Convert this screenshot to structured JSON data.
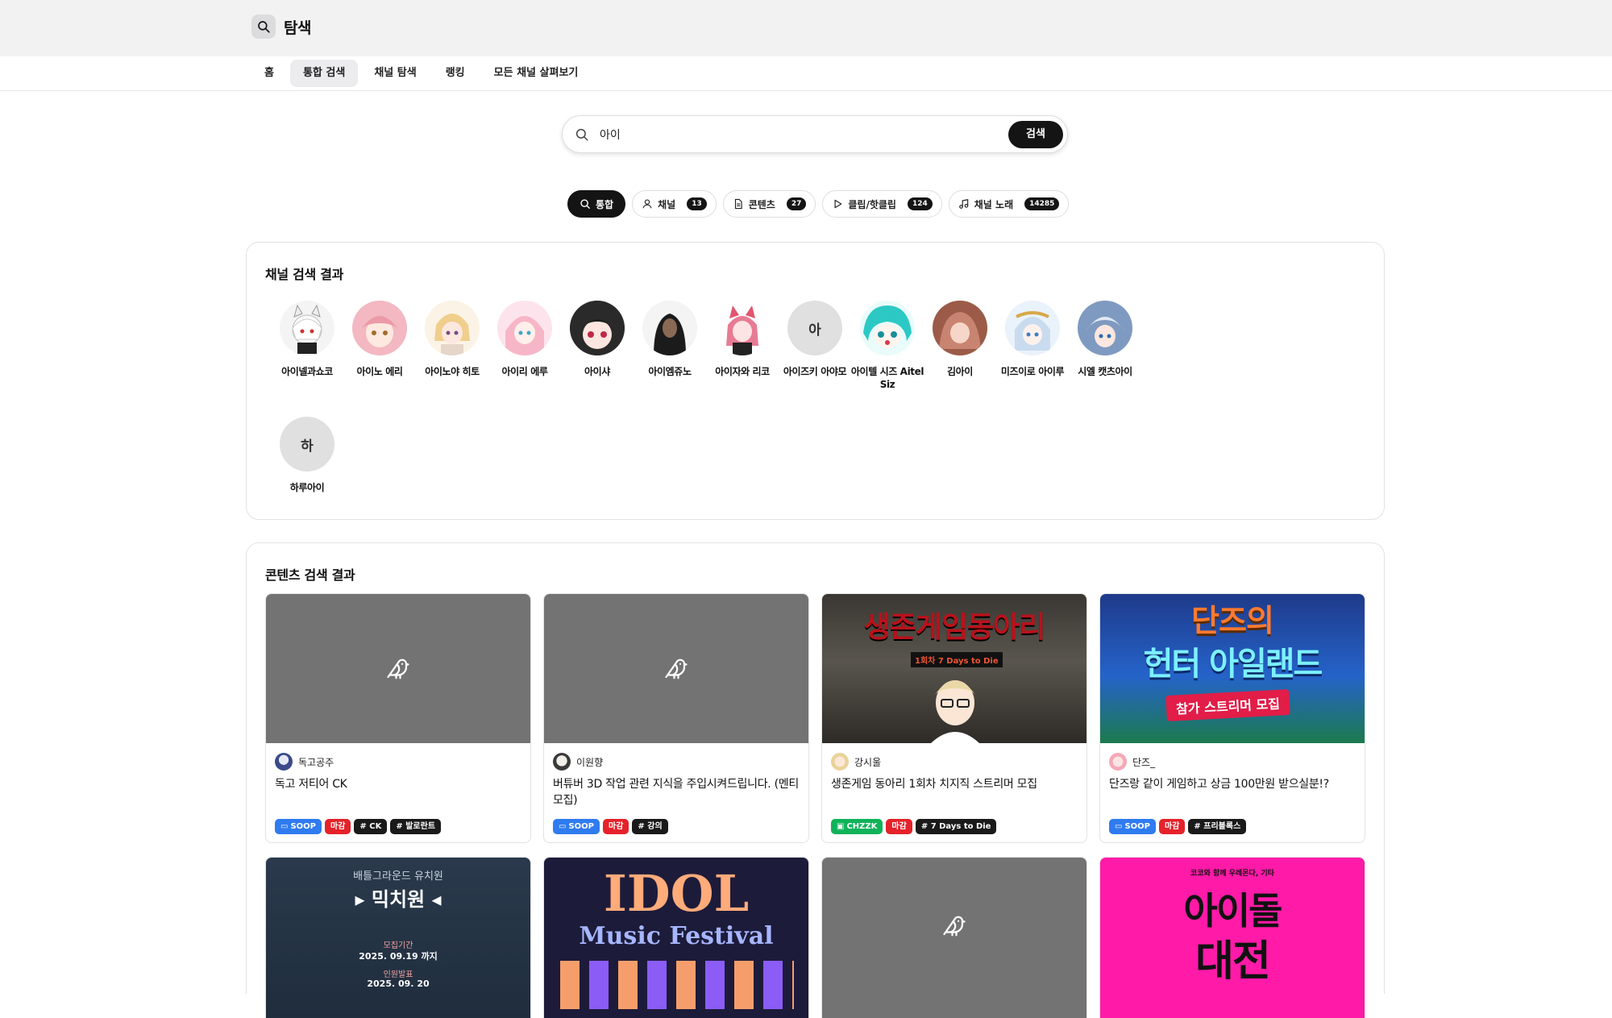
{
  "header": {
    "title": "탐색"
  },
  "nav": {
    "items": [
      {
        "label": "홈"
      },
      {
        "label": "통합 검색"
      },
      {
        "label": "채널 탐색"
      },
      {
        "label": "랭킹"
      },
      {
        "label": "모든 채널 살펴보기"
      }
    ]
  },
  "search": {
    "value": "아이",
    "button_label": "검색"
  },
  "filters": [
    {
      "label": "통합",
      "icon": "search-icon"
    },
    {
      "label": "채널",
      "count": "13",
      "icon": "user-icon"
    },
    {
      "label": "콘텐츠",
      "count": "27",
      "icon": "document-icon"
    },
    {
      "label": "클립/핫클립",
      "count": "124",
      "icon": "play-icon"
    },
    {
      "label": "채널 노래",
      "count": "14285",
      "icon": "music-icon"
    }
  ],
  "channels": {
    "title": "채널 검색 결과",
    "items": [
      {
        "name": "아이넬과쇼코"
      },
      {
        "name": "아이노 에리"
      },
      {
        "name": "아이노야 히토"
      },
      {
        "name": "아이리 에루"
      },
      {
        "name": "아이샤"
      },
      {
        "name": "아이엠쥬노"
      },
      {
        "name": "아이자와 리코"
      },
      {
        "name": "아이즈키 아야모",
        "initial": "아"
      },
      {
        "name": "아이텔 시즈 Aitel Siz"
      },
      {
        "name": "김아이"
      },
      {
        "name": "미즈이로 아이루"
      },
      {
        "name": "시엘 캣츠아이"
      },
      {
        "name": "하루아이",
        "initial": "하"
      }
    ]
  },
  "contents": {
    "title": "콘텐츠 검색 결과",
    "cards": [
      {
        "author": "독고공주",
        "title": "독고 저티어 CK",
        "platform": "SOOP",
        "status": "마감",
        "tags": [
          "# CK",
          "# 발로란트"
        ]
      },
      {
        "author": "이원향",
        "title": "버튜버 3D 작업 관련 지식을 주입시켜드립니다. (멘티 모집)",
        "platform": "SOOP",
        "status": "마감",
        "tags": [
          "# 강의"
        ]
      },
      {
        "author": "강시울",
        "title": "생존게임 동아리 1회차 치지직 스트리머 모집",
        "platform": "CHZZK",
        "status": "마감",
        "tags": [
          "# 7 Days to Die"
        ],
        "thumb_title": "생존게임동아리",
        "thumb_sub": "1회차 7 Days to Die"
      },
      {
        "author": "단즈_",
        "title": "단즈랑 같이 게임하고 상금 100만원 받으실분!?",
        "platform": "SOOP",
        "status": "마감",
        "tags": [
          "# 프리블록스"
        ],
        "thumb_title1": "단즈의",
        "thumb_title2": "헌터 아일랜드",
        "thumb_banner": "참가 스트리머 모집"
      }
    ],
    "row2": [
      {
        "thumb_top": "배틀그라운드 유치원",
        "thumb_title": "믹치원",
        "thumb_label": "모집기간",
        "thumb_date": "2025. 09.19 까지",
        "thumb_label2": "인원발표",
        "thumb_date2": "2025. 09. 20"
      },
      {
        "thumb_title1": "IDOL",
        "thumb_title2": "Music Festival"
      },
      {},
      {
        "thumb_top": "코코와 함께 우레몬다, 기타",
        "thumb_title1": "아이돌",
        "thumb_title2": "대전"
      }
    ]
  },
  "colors": {
    "soop": "#2f7bf0",
    "chzzk": "#10b35a",
    "closed": "#e5222a",
    "dark": "#141414"
  }
}
